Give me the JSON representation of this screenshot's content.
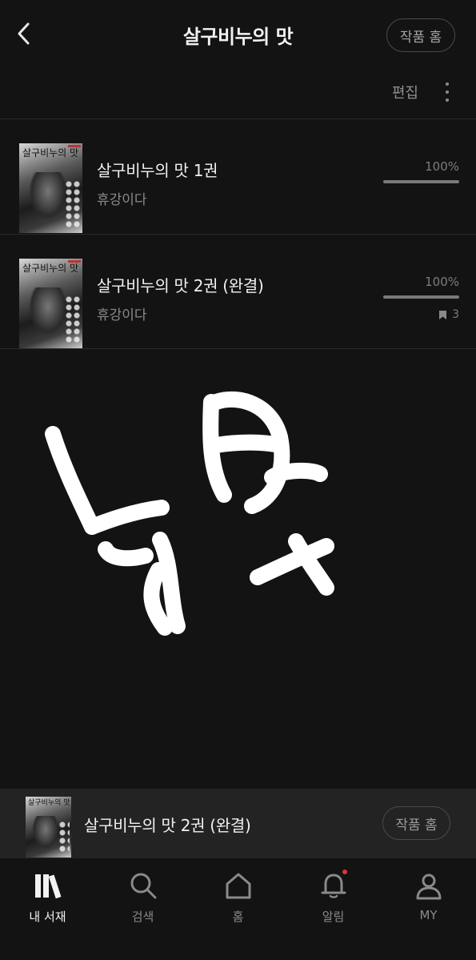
{
  "header": {
    "title": "살구비누의 맛",
    "home_button": "작품 홈"
  },
  "toolbar": {
    "edit_label": "편집"
  },
  "books": [
    {
      "title": "살구비누의 맛 1권",
      "author": "휴강이다",
      "progress_text": "100%",
      "progress": 1.0,
      "cover_title": "살구비누의 맛"
    },
    {
      "title": "살구비누의 맛 2권 (완결)",
      "author": "휴강이다",
      "progress_text": "100%",
      "progress": 1.0,
      "bookmark_count": "3",
      "cover_title": "살구비누의 맛"
    }
  ],
  "now_reading": {
    "title": "살구비누의 맛 2권 (완결)",
    "home_button": "작품 홈",
    "cover_title": "살구비누의 맛"
  },
  "bottom_nav": [
    {
      "label": "내 서재",
      "icon": "library-icon",
      "active": true
    },
    {
      "label": "검색",
      "icon": "search-icon",
      "active": false
    },
    {
      "label": "홈",
      "icon": "home-icon",
      "active": false
    },
    {
      "label": "알림",
      "icon": "bell-icon",
      "active": false,
      "badge": true
    },
    {
      "label": "MY",
      "icon": "profile-icon",
      "active": false
    }
  ],
  "colors": {
    "background": "#131313",
    "panel": "#232323",
    "notification_dot": "#e0353a"
  }
}
